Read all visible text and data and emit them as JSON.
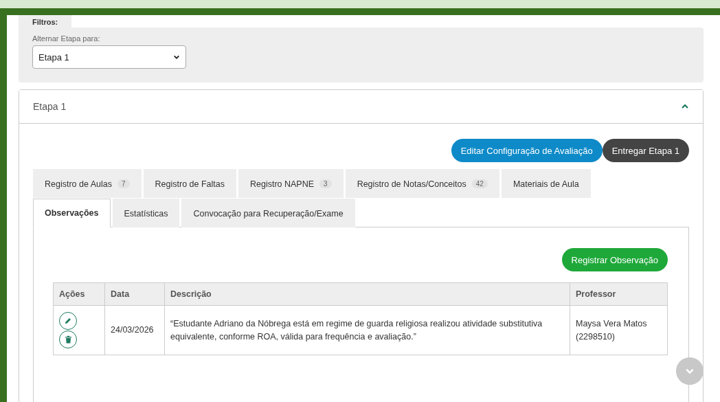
{
  "filters": {
    "title": "Filtros:",
    "label": "Alternar Etapa para:",
    "select_value": "Etapa 1"
  },
  "stage": {
    "title": "Etapa 1",
    "expanded": true,
    "actions": [
      {
        "label": "Editar Configuração de Avaliação",
        "kind": "primary"
      },
      {
        "label": "Entregar Etapa 1",
        "kind": "dark"
      }
    ],
    "tab_rows": [
      [
        {
          "label": "Registro de Aulas",
          "badge": "7",
          "selected": false
        },
        {
          "label": "Registro de Faltas",
          "selected": false
        },
        {
          "label": "Registro NAPNE",
          "badge": "3",
          "selected": false
        },
        {
          "label": "Registro de Notas/Conceitos",
          "badge": "42",
          "selected": false
        },
        {
          "label": "Materiais de Aula",
          "selected": false
        }
      ],
      [
        {
          "label": "Observações",
          "selected": true
        },
        {
          "label": "Estatísticas",
          "selected": false
        },
        {
          "label": "Convocação para Recuperação/Exame",
          "selected": false
        }
      ]
    ],
    "add_button": "Registrar Observação",
    "table": {
      "columns": [
        "Ações",
        "Data",
        "Descrição",
        "Professor"
      ],
      "rows": [
        {
          "date": "24/03/2026",
          "description": "“Estudante Adriano da Nóbrega está em regime de guarda religiosa realizou atividade substitutiva equivalente, conforme ROA, válida para frequência e avaliação.”",
          "professor": "Maysa Vera Matos (2298510)"
        }
      ]
    }
  }
}
